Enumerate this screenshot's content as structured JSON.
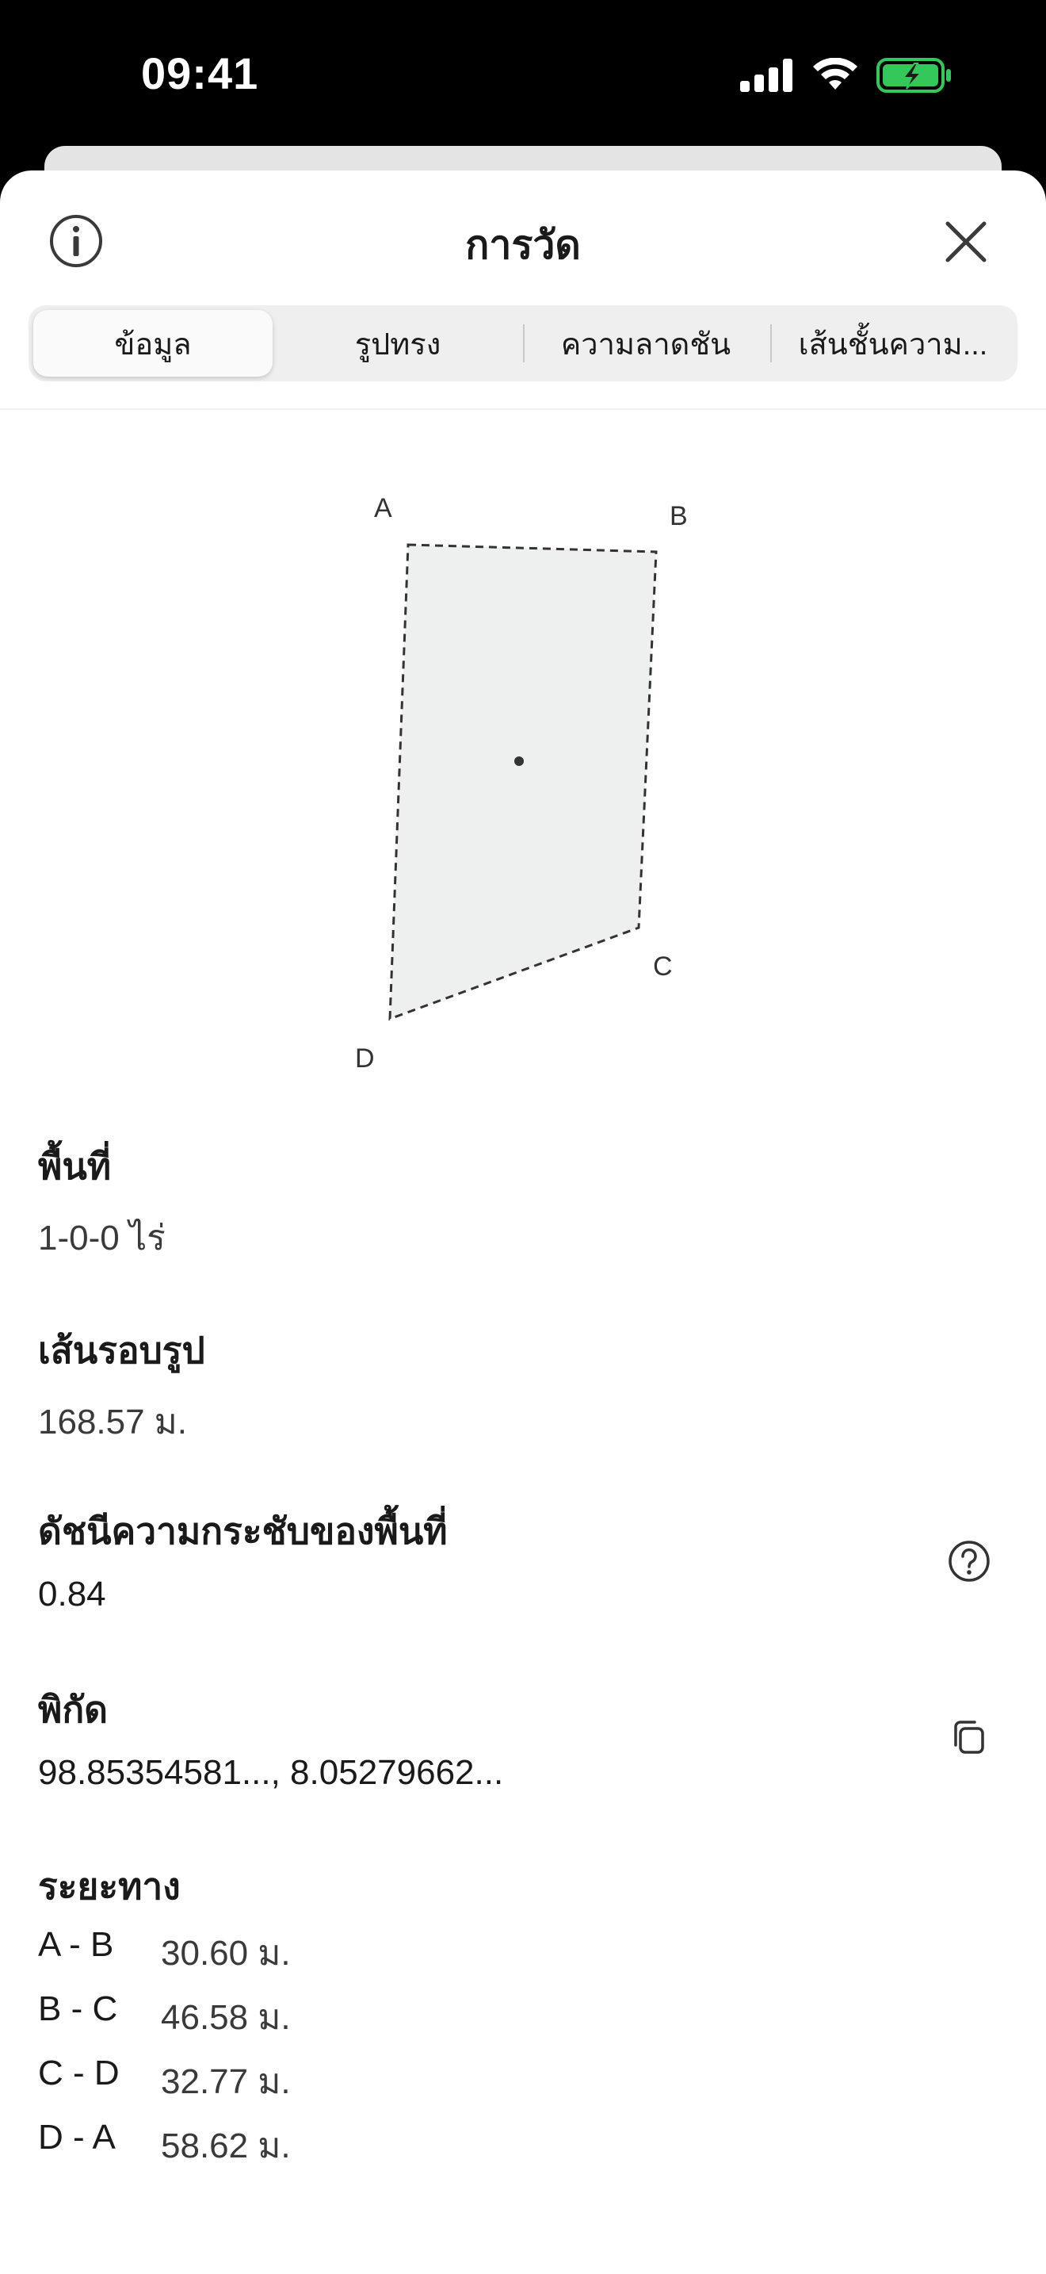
{
  "status_bar": {
    "time": "09:41",
    "icons": [
      "signal-icon",
      "wifi-icon",
      "battery-charging-icon"
    ],
    "battery_color": "#34c759"
  },
  "header": {
    "title": "การวัด",
    "info_icon": "info-icon",
    "close_icon": "close-icon"
  },
  "tabs": [
    {
      "label": "ข้อมูล",
      "active": true
    },
    {
      "label": "รูปทรง",
      "active": false
    },
    {
      "label": "ความลาดชัน",
      "active": false
    },
    {
      "label": "เส้นชั้นความ...",
      "active": false
    }
  ],
  "shape": {
    "vertices": [
      "A",
      "B",
      "C",
      "D"
    ],
    "fill_color": "#eef0ef"
  },
  "fields": {
    "area": {
      "label": "พื้นที่",
      "value": "1-0-0 ไร่"
    },
    "perimeter": {
      "label": "เส้นรอบรูป",
      "value": "168.57 ม."
    },
    "compactness": {
      "label": "ดัชนีความกระชับของพื้นที่",
      "value": "0.84",
      "icon": "help-icon"
    },
    "coordinates": {
      "label": "พิกัด",
      "value": "98.85354581..., 8.05279662...",
      "icon": "copy-icon"
    }
  },
  "distances": {
    "label": "ระยะทาง",
    "rows": [
      {
        "segment": "A - B",
        "value": "30.60 ม."
      },
      {
        "segment": "B - C",
        "value": "46.58 ม."
      },
      {
        "segment": "C - D",
        "value": "32.77 ม."
      },
      {
        "segment": "D - A",
        "value": "58.62 ม."
      }
    ]
  }
}
